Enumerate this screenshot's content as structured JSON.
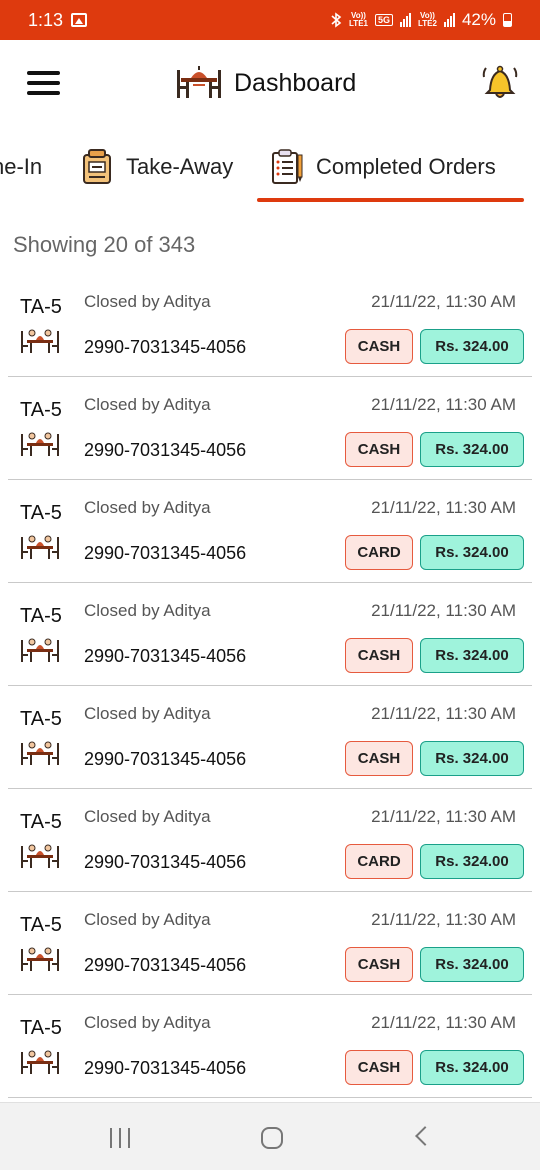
{
  "status_bar": {
    "time": "1:13",
    "carrier1_top": "Vo))",
    "carrier1_bottom": "LTE1",
    "network": "5G",
    "carrier2_top": "Vo))",
    "carrier2_bottom": "LTE2",
    "battery": "42%",
    "icons": [
      "gallery-icon",
      "bluetooth-icon",
      "signal-icon",
      "battery-icon"
    ]
  },
  "app_bar": {
    "title": "Dashboard",
    "icons": [
      "menu-icon",
      "restaurant-logo-icon",
      "bell-icon"
    ]
  },
  "tabs": [
    {
      "label": "ne-In",
      "icon": "dine-in-icon"
    },
    {
      "label": "Take-Away",
      "icon": "takeaway-bag-icon"
    },
    {
      "label": "Completed Orders",
      "icon": "clipboard-icon",
      "active": true
    }
  ],
  "showing_text": "Showing 20 of 343",
  "orders": [
    {
      "id": "TA-5",
      "closed_by": "Closed by Aditya",
      "datetime": "21/11/22, 11:30 AM",
      "number": "2990-7031345-4056",
      "payment": "CASH",
      "amount": "Rs. 324.00"
    },
    {
      "id": "TA-5",
      "closed_by": "Closed by Aditya",
      "datetime": "21/11/22, 11:30 AM",
      "number": "2990-7031345-4056",
      "payment": "CASH",
      "amount": "Rs. 324.00"
    },
    {
      "id": "TA-5",
      "closed_by": "Closed by Aditya",
      "datetime": "21/11/22, 11:30 AM",
      "number": "2990-7031345-4056",
      "payment": "CARD",
      "amount": "Rs. 324.00"
    },
    {
      "id": "TA-5",
      "closed_by": "Closed by Aditya",
      "datetime": "21/11/22, 11:30 AM",
      "number": "2990-7031345-4056",
      "payment": "CASH",
      "amount": "Rs. 324.00"
    },
    {
      "id": "TA-5",
      "closed_by": "Closed by Aditya",
      "datetime": "21/11/22, 11:30 AM",
      "number": "2990-7031345-4056",
      "payment": "CASH",
      "amount": "Rs. 324.00"
    },
    {
      "id": "TA-5",
      "closed_by": "Closed by Aditya",
      "datetime": "21/11/22, 11:30 AM",
      "number": "2990-7031345-4056",
      "payment": "CARD",
      "amount": "Rs. 324.00"
    },
    {
      "id": "TA-5",
      "closed_by": "Closed by Aditya",
      "datetime": "21/11/22, 11:30 AM",
      "number": "2990-7031345-4056",
      "payment": "CASH",
      "amount": "Rs. 324.00"
    },
    {
      "id": "TA-5",
      "closed_by": "Closed by Aditya",
      "datetime": "21/11/22, 11:30 AM",
      "number": "2990-7031345-4056",
      "payment": "CASH",
      "amount": "Rs. 324.00"
    }
  ],
  "nav_bar": {
    "icons": [
      "recent-apps-icon",
      "home-icon",
      "back-icon"
    ]
  },
  "colors": {
    "accent": "#de3a0e",
    "payment_bg": "#fde6e1",
    "payment_border": "#e65a3e",
    "amount_bg": "#9ff3dc",
    "amount_border": "#1aa089"
  }
}
